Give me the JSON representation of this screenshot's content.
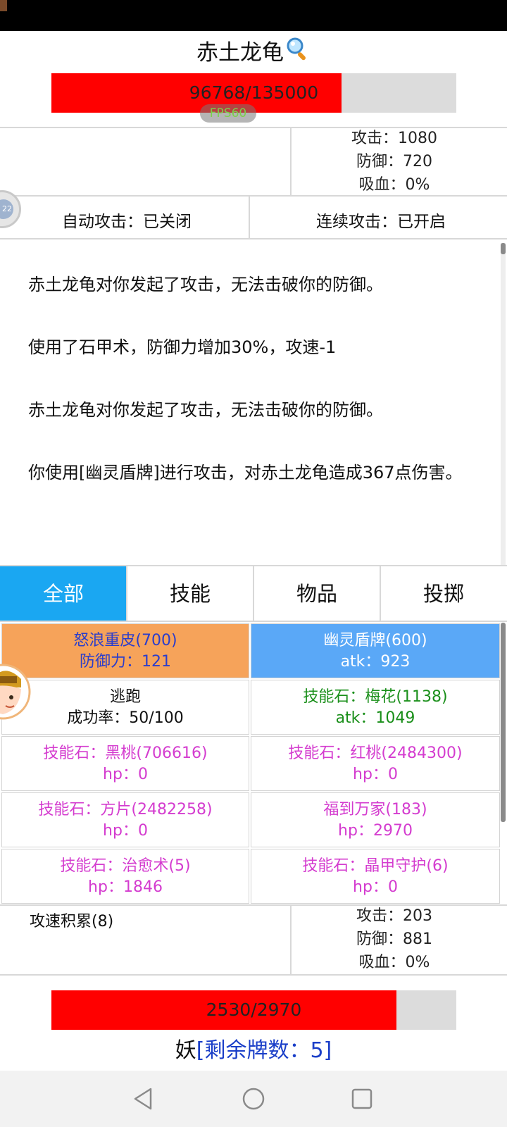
{
  "enemy": {
    "name": "赤土龙龟",
    "hp_text": "96768/135000",
    "hp_fraction": 0.717,
    "fps": "FPS60",
    "stats": [
      "攻击：1080",
      "防御：720",
      "吸血：0%"
    ]
  },
  "toggles": {
    "auto_attack": "自动攻击：已关闭",
    "continuous_attack": "连续攻击：已开启"
  },
  "side_badge": "22",
  "log": [
    "赤土龙龟对你发起了攻击，无法击破你的防御。",
    "使用了石甲术，防御力增加30%，攻速-1",
    "赤土龙龟对你发起了攻击，无法击破你的防御。",
    "你使用[幽灵盾牌]进行攻击，对赤土龙龟造成367点伤害。"
  ],
  "tabs": [
    "全部",
    "技能",
    "物品",
    "投掷"
  ],
  "cards": [
    {
      "name": "怒浪重皮(700)",
      "stat": "防御力：121",
      "style": "orange"
    },
    {
      "name": "幽灵盾牌(600)",
      "stat": "atk：923",
      "style": "blue"
    },
    {
      "name": "逃跑",
      "stat": "成功率：50/100",
      "style": "white"
    },
    {
      "name": "技能石：梅花(1138)",
      "stat": "atk：1049",
      "style": "green"
    },
    {
      "name": "技能石：黑桃(706616)",
      "stat": "hp：0",
      "style": "pink"
    },
    {
      "name": "技能石：红桃(2484300)",
      "stat": "hp：0",
      "style": "pink"
    },
    {
      "name": "技能石：方片(2482258)",
      "stat": "hp：0",
      "style": "pink"
    },
    {
      "name": "福到万家(183)",
      "stat": "hp：2970",
      "style": "pink"
    },
    {
      "name": "技能石：治愈术(5)",
      "stat": "hp：1846",
      "style": "pink"
    },
    {
      "name": "技能石：晶甲守护(6)",
      "stat": "hp：0",
      "style": "pink"
    }
  ],
  "player": {
    "buff": "攻速积累(8)",
    "stats": [
      "攻击：203",
      "防御：881",
      "吸血：0%"
    ],
    "hp_text": "2530/2970",
    "hp_fraction": 0.852,
    "deck_prefix": "妖",
    "deck_label": "[剩余牌数：5]"
  },
  "colors": {
    "hp_fill": "#ff0000",
    "tab_active": "#1aa7f2",
    "card_orange": "#f6a35a",
    "card_blue": "#5aa8f7",
    "card_green_text": "#1a8f1a",
    "card_pink_text": "#d43ccf"
  }
}
